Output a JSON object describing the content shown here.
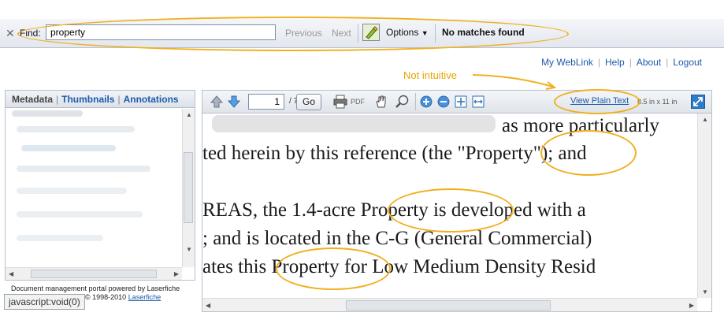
{
  "findbar": {
    "close_glyph": "✕",
    "label": "Find:",
    "query": "property",
    "previous": "Previous",
    "next": "Next",
    "options": "Options",
    "status": "No matches found",
    "highlight_icon": "highlighter-icon"
  },
  "toplinks": {
    "my_weblink": "My WebLink",
    "help": "Help",
    "about": "About",
    "logout": "Logout"
  },
  "annotation": {
    "note": "Not intuitive",
    "color": "#f0b020"
  },
  "leftpanel": {
    "tab_metadata": "Metadata",
    "tab_thumbnails": "Thumbnails",
    "tab_annotations": "Annotations"
  },
  "footer": {
    "powered": "Document management portal powered by Laserfiche",
    "copyright_prefix": "© 1998-2010",
    "copyright_link": "Laserfiche",
    "status_url": "javascript:void(0)"
  },
  "viewer": {
    "page_number": "1",
    "page_total": "/ 7",
    "go": "Go",
    "pdf": "PDF",
    "view_plain_text": "View Plain Text",
    "page_size": "8.5 in x 11 in",
    "doc_lines": [
      "as more particularly",
      "ted herein by this reference (the \"Property\"); and",
      "REAS, the 1.4-acre Property is developed with a",
      "; and is located in the C-G (General Commercial)",
      "ates this Property for Low Medium Density Resid"
    ]
  },
  "colors": {
    "link": "#1e5aa8",
    "highlight_oval": "#f0b020"
  }
}
